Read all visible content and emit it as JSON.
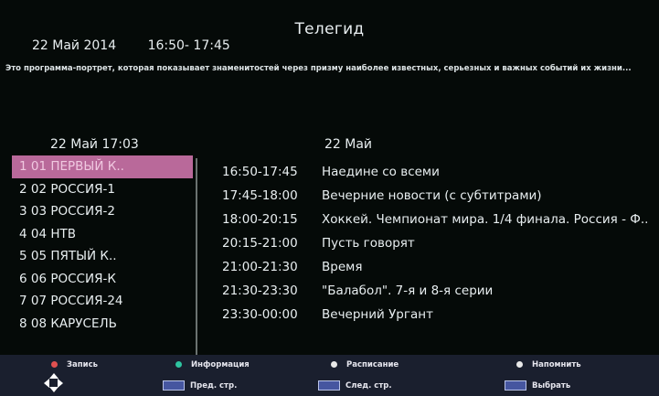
{
  "header": {
    "title": "Телегид",
    "date": "22 Май 2014",
    "time_range": "16:50- 17:45",
    "description": "Это программа-портрет, которая показывает знаменитостей через призму наиболее известных, серьезных и важных событий их жизни..."
  },
  "channel_list": {
    "header": "22 Май 17:03",
    "items": [
      {
        "label": "1 01 ПЕРВЫЙ К..",
        "selected": true
      },
      {
        "label": "2 02 РОССИЯ-1"
      },
      {
        "label": "3 03 РОССИЯ-2"
      },
      {
        "label": "4 04 НТВ"
      },
      {
        "label": "5 05 ПЯТЫЙ К.."
      },
      {
        "label": "6 06 РОССИЯ-К"
      },
      {
        "label": "7 07 РОССИЯ-24"
      },
      {
        "label": "8 08 КАРУСЕЛЬ"
      }
    ]
  },
  "schedule": {
    "header": "22 Май",
    "items": [
      {
        "time": "16:50-17:45",
        "name": "Наедине со всеми"
      },
      {
        "time": "17:45-18:00",
        "name": "Вечерние новости (с субтитрами)"
      },
      {
        "time": "18:00-20:15",
        "name": "Хоккей. Чемпионат мира. 1/4 финала. Россия - Ф.."
      },
      {
        "time": "20:15-21:00",
        "name": "Пусть говорят"
      },
      {
        "time": "21:00-21:30",
        "name": "Время"
      },
      {
        "time": "21:30-23:30",
        "name": "\"Балабол\". 7-я и 8-я серии"
      },
      {
        "time": "23:30-00:00",
        "name": "Вечерний Ургант"
      }
    ]
  },
  "footer": {
    "record": {
      "label": "Запись",
      "color": "#e05050"
    },
    "info": {
      "label": "Информация",
      "color": "#2ec4a0"
    },
    "schedule": {
      "label": "Расписание",
      "color": "#e8e8e8"
    },
    "remind": {
      "label": "Напомнить",
      "color": "#e8e8e8"
    },
    "prev_page": "Пред. стр.",
    "next_page": "След. стр.",
    "select": "Выбрать"
  },
  "colors": {
    "background": "#050a08",
    "selected_row": "#b9699a",
    "footer_bar": "#1a1f2e"
  }
}
